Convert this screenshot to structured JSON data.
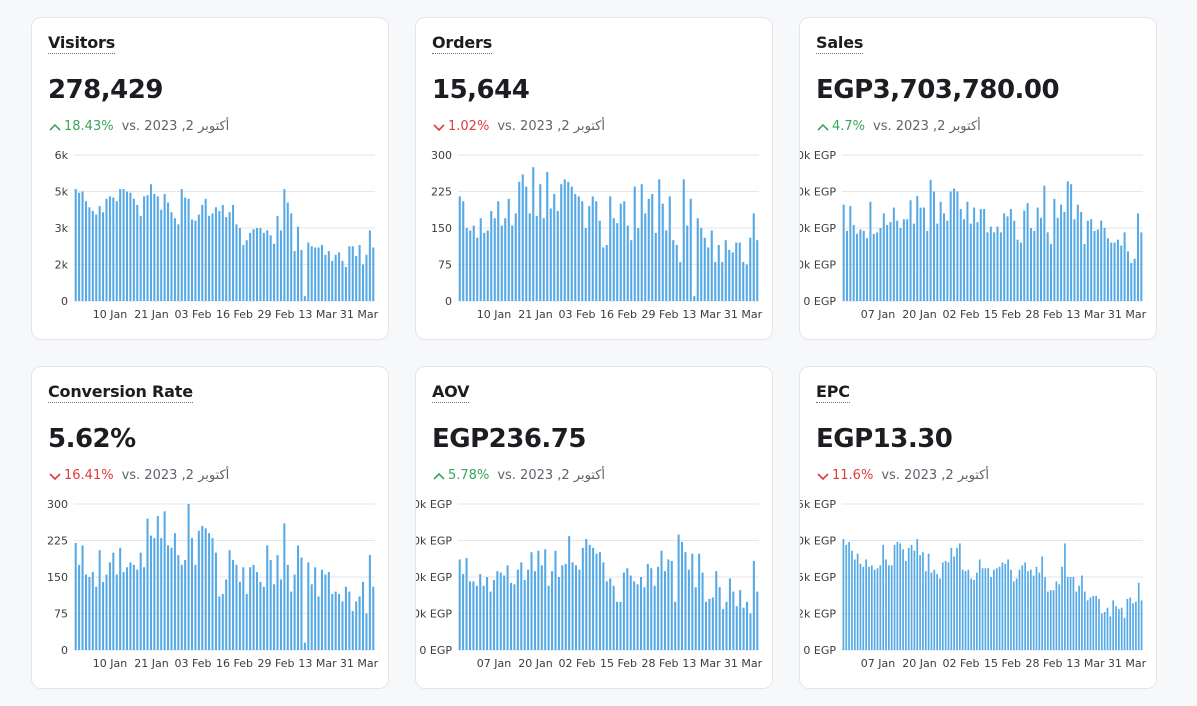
{
  "colors": {
    "bar": "#55a9e6",
    "up": "#3aa55d",
    "down": "#e03b3b",
    "grid": "#e4e6ea"
  },
  "cards": [
    {
      "title": "Visitors",
      "value": "278,429",
      "delta": {
        "direction": "up",
        "percent": "18.43%",
        "compare": "vs. 2023 ,2 أكتوبر"
      },
      "chart_data": {
        "type": "bar",
        "ytick_labels": [
          "6k",
          "5k",
          "3k",
          "2k",
          "0"
        ],
        "ylim": [
          0,
          6000
        ],
        "xtick_labels": [
          "10 Jan",
          "21 Jan",
          "03 Feb",
          "16 Feb",
          "29 Feb",
          "13 Mar",
          "31 Mar"
        ],
        "values": [
          4600,
          4450,
          4500,
          4100,
          3850,
          3700,
          3550,
          3900,
          3650,
          4200,
          4300,
          4250,
          4100,
          4600,
          4600,
          4500,
          4450,
          4200,
          3950,
          3500,
          4300,
          4350,
          4800,
          4400,
          4300,
          3750,
          4400,
          4050,
          3650,
          3400,
          3150,
          4600,
          4250,
          4200,
          3350,
          3300,
          3550,
          3950,
          4200,
          3500,
          3600,
          3850,
          3700,
          3950,
          3450,
          3650,
          3950,
          3150,
          3000,
          2300,
          2500,
          2800,
          2950,
          3000,
          3000,
          2800,
          2900,
          2700,
          2350,
          3500,
          2900,
          4600,
          4050,
          3600,
          2050,
          3050,
          2100,
          200,
          2400,
          2250,
          2200,
          2200,
          2300,
          1900,
          2050,
          1650,
          1900,
          2000,
          1650,
          1400,
          2250,
          2250,
          1850,
          2300,
          1500,
          1900,
          2900,
          2200
        ]
      }
    },
    {
      "title": "Orders",
      "value": "15,644",
      "delta": {
        "direction": "down",
        "percent": "1.02%",
        "compare": "vs. 2023 ,2 أكتوبر"
      },
      "chart_data": {
        "type": "bar",
        "ytick_labels": [
          "300",
          "225",
          "150",
          "75",
          "0"
        ],
        "ylim": [
          0,
          300
        ],
        "xtick_labels": [
          "10 Jan",
          "21 Jan",
          "03 Feb",
          "16 Feb",
          "29 Feb",
          "13 Mar",
          "31 Mar"
        ],
        "values": [
          215,
          205,
          150,
          145,
          155,
          130,
          170,
          140,
          145,
          185,
          170,
          205,
          155,
          170,
          210,
          155,
          180,
          245,
          260,
          235,
          180,
          275,
          175,
          240,
          170,
          265,
          190,
          220,
          185,
          240,
          250,
          245,
          235,
          220,
          215,
          205,
          150,
          195,
          215,
          205,
          165,
          110,
          115,
          215,
          170,
          160,
          200,
          205,
          155,
          125,
          235,
          150,
          240,
          180,
          210,
          220,
          140,
          250,
          200,
          145,
          215,
          125,
          115,
          80,
          250,
          155,
          210,
          10,
          170,
          150,
          130,
          110,
          145,
          80,
          115,
          80,
          125,
          105,
          100,
          120,
          120,
          80,
          75,
          130,
          180,
          125
        ]
      }
    },
    {
      "title": "Sales",
      "value": "EGP3,703,780.00",
      "delta": {
        "direction": "up",
        "percent": "4.7%",
        "compare": "vs. 2023 ,2 أكتوبر"
      },
      "chart_data": {
        "type": "bar",
        "ytick_labels": [
          "0k EGP",
          "0k EGP",
          "0k EGP",
          "0k EGP",
          "0 EGP"
        ],
        "ylim": [
          0,
          100
        ],
        "xtick_labels": [
          "07 Jan",
          "20 Jan",
          "02 Feb",
          "15 Feb",
          "28 Feb",
          "13 Mar",
          "31 Mar"
        ],
        "values": [
          66,
          48,
          65,
          52,
          46,
          49,
          48,
          43,
          68,
          46,
          47,
          50,
          60,
          52,
          54,
          64,
          55,
          50,
          56,
          56,
          69,
          53,
          72,
          64,
          64,
          48,
          83,
          75,
          53,
          68,
          60,
          55,
          75,
          77,
          75,
          63,
          56,
          68,
          53,
          64,
          54,
          63,
          63,
          47,
          51,
          47,
          51,
          47,
          60,
          58,
          63,
          55,
          42,
          40,
          62,
          67,
          50,
          48,
          64,
          57,
          79,
          47,
          39,
          70,
          57,
          66,
          61,
          82,
          80,
          56,
          66,
          61,
          39,
          55,
          56,
          48,
          49,
          55,
          50,
          43,
          40,
          40,
          42,
          38,
          47,
          34,
          26,
          29,
          60,
          47
        ]
      }
    },
    {
      "title": "Conversion Rate",
      "value": "5.62%",
      "delta": {
        "direction": "down",
        "percent": "16.41%",
        "compare": "vs. 2023 ,2 أكتوبر"
      },
      "chart_data": {
        "type": "bar",
        "ytick_labels": [
          "300",
          "225",
          "150",
          "75",
          "0"
        ],
        "ylim": [
          0,
          300
        ],
        "xtick_labels": [
          "10 Jan",
          "21 Jan",
          "03 Feb",
          "16 Feb",
          "29 Feb",
          "13 Mar",
          "31 Mar"
        ],
        "values": [
          220,
          175,
          215,
          155,
          150,
          160,
          130,
          205,
          140,
          155,
          180,
          200,
          155,
          210,
          160,
          170,
          180,
          175,
          165,
          200,
          170,
          270,
          235,
          230,
          275,
          230,
          285,
          215,
          210,
          240,
          195,
          175,
          185,
          300,
          230,
          175,
          245,
          255,
          250,
          240,
          230,
          200,
          110,
          115,
          145,
          205,
          185,
          175,
          140,
          170,
          115,
          170,
          175,
          160,
          140,
          130,
          215,
          185,
          135,
          195,
          145,
          260,
          175,
          120,
          155,
          215,
          190,
          15,
          180,
          135,
          170,
          110,
          165,
          155,
          160,
          115,
          120,
          115,
          100,
          130,
          120,
          80,
          100,
          110,
          140,
          75,
          195,
          130
        ]
      }
    },
    {
      "title": "AOV",
      "value": "EGP236.75",
      "delta": {
        "direction": "up",
        "percent": "5.78%",
        "compare": "vs. 2023 ,2 أكتوبر"
      },
      "chart_data": {
        "type": "bar",
        "ytick_labels": [
          "0k EGP",
          "0k EGP",
          "0k EGP",
          "0k EGP",
          "0 EGP"
        ],
        "ylim": [
          0,
          100
        ],
        "xtick_labels": [
          "07 Jan",
          "20 Jan",
          "02 Feb",
          "15 Feb",
          "28 Feb",
          "13 Mar",
          "31 Mar"
        ],
        "values": [
          62,
          52,
          63,
          47,
          47,
          44,
          52,
          44,
          50,
          40,
          48,
          54,
          53,
          51,
          58,
          46,
          45,
          55,
          60,
          48,
          55,
          67,
          54,
          68,
          58,
          69,
          44,
          54,
          68,
          50,
          58,
          59,
          78,
          60,
          58,
          55,
          70,
          76,
          72,
          70,
          66,
          67,
          60,
          47,
          49,
          44,
          33,
          33,
          53,
          56,
          51,
          47,
          45,
          50,
          43,
          59,
          56,
          44,
          57,
          68,
          54,
          62,
          61,
          33,
          79,
          74,
          67,
          55,
          66,
          43,
          66,
          53,
          33,
          35,
          36,
          54,
          43,
          28,
          33,
          49,
          40,
          30,
          41,
          29,
          33,
          25,
          61,
          40
        ]
      }
    },
    {
      "title": "EPC",
      "value": "EGP13.30",
      "delta": {
        "direction": "down",
        "percent": "11.6%",
        "compare": "vs. 2023 ,2 أكتوبر"
      },
      "chart_data": {
        "type": "bar",
        "ytick_labels": [
          "5k EGP",
          "0k EGP",
          "5k EGP",
          "2k EGP",
          "0 EGP"
        ],
        "ylim": [
          0,
          100
        ],
        "xtick_labels": [
          "07 Jan",
          "20 Jan",
          "02 Feb",
          "15 Feb",
          "28 Feb",
          "13 Mar",
          "31 Mar"
        ],
        "values": [
          76,
          72,
          74,
          68,
          62,
          66,
          59,
          57,
          62,
          57,
          58,
          55,
          56,
          58,
          72,
          62,
          58,
          58,
          72,
          74,
          73,
          69,
          61,
          70,
          72,
          68,
          76,
          65,
          67,
          54,
          66,
          53,
          55,
          52,
          49,
          60,
          61,
          60,
          70,
          64,
          70,
          73,
          55,
          54,
          55,
          49,
          48,
          53,
          62,
          56,
          56,
          56,
          50,
          55,
          56,
          57,
          60,
          59,
          62,
          55,
          47,
          49,
          55,
          58,
          60,
          54,
          55,
          51,
          57,
          53,
          64,
          50,
          40,
          41,
          41,
          47,
          45,
          57,
          73,
          50,
          50,
          50,
          40,
          44,
          51,
          40,
          34,
          36,
          37,
          37,
          35,
          25,
          26,
          29,
          23,
          34,
          30,
          28,
          29,
          22,
          35,
          36,
          32,
          33,
          46,
          34
        ]
      }
    }
  ]
}
